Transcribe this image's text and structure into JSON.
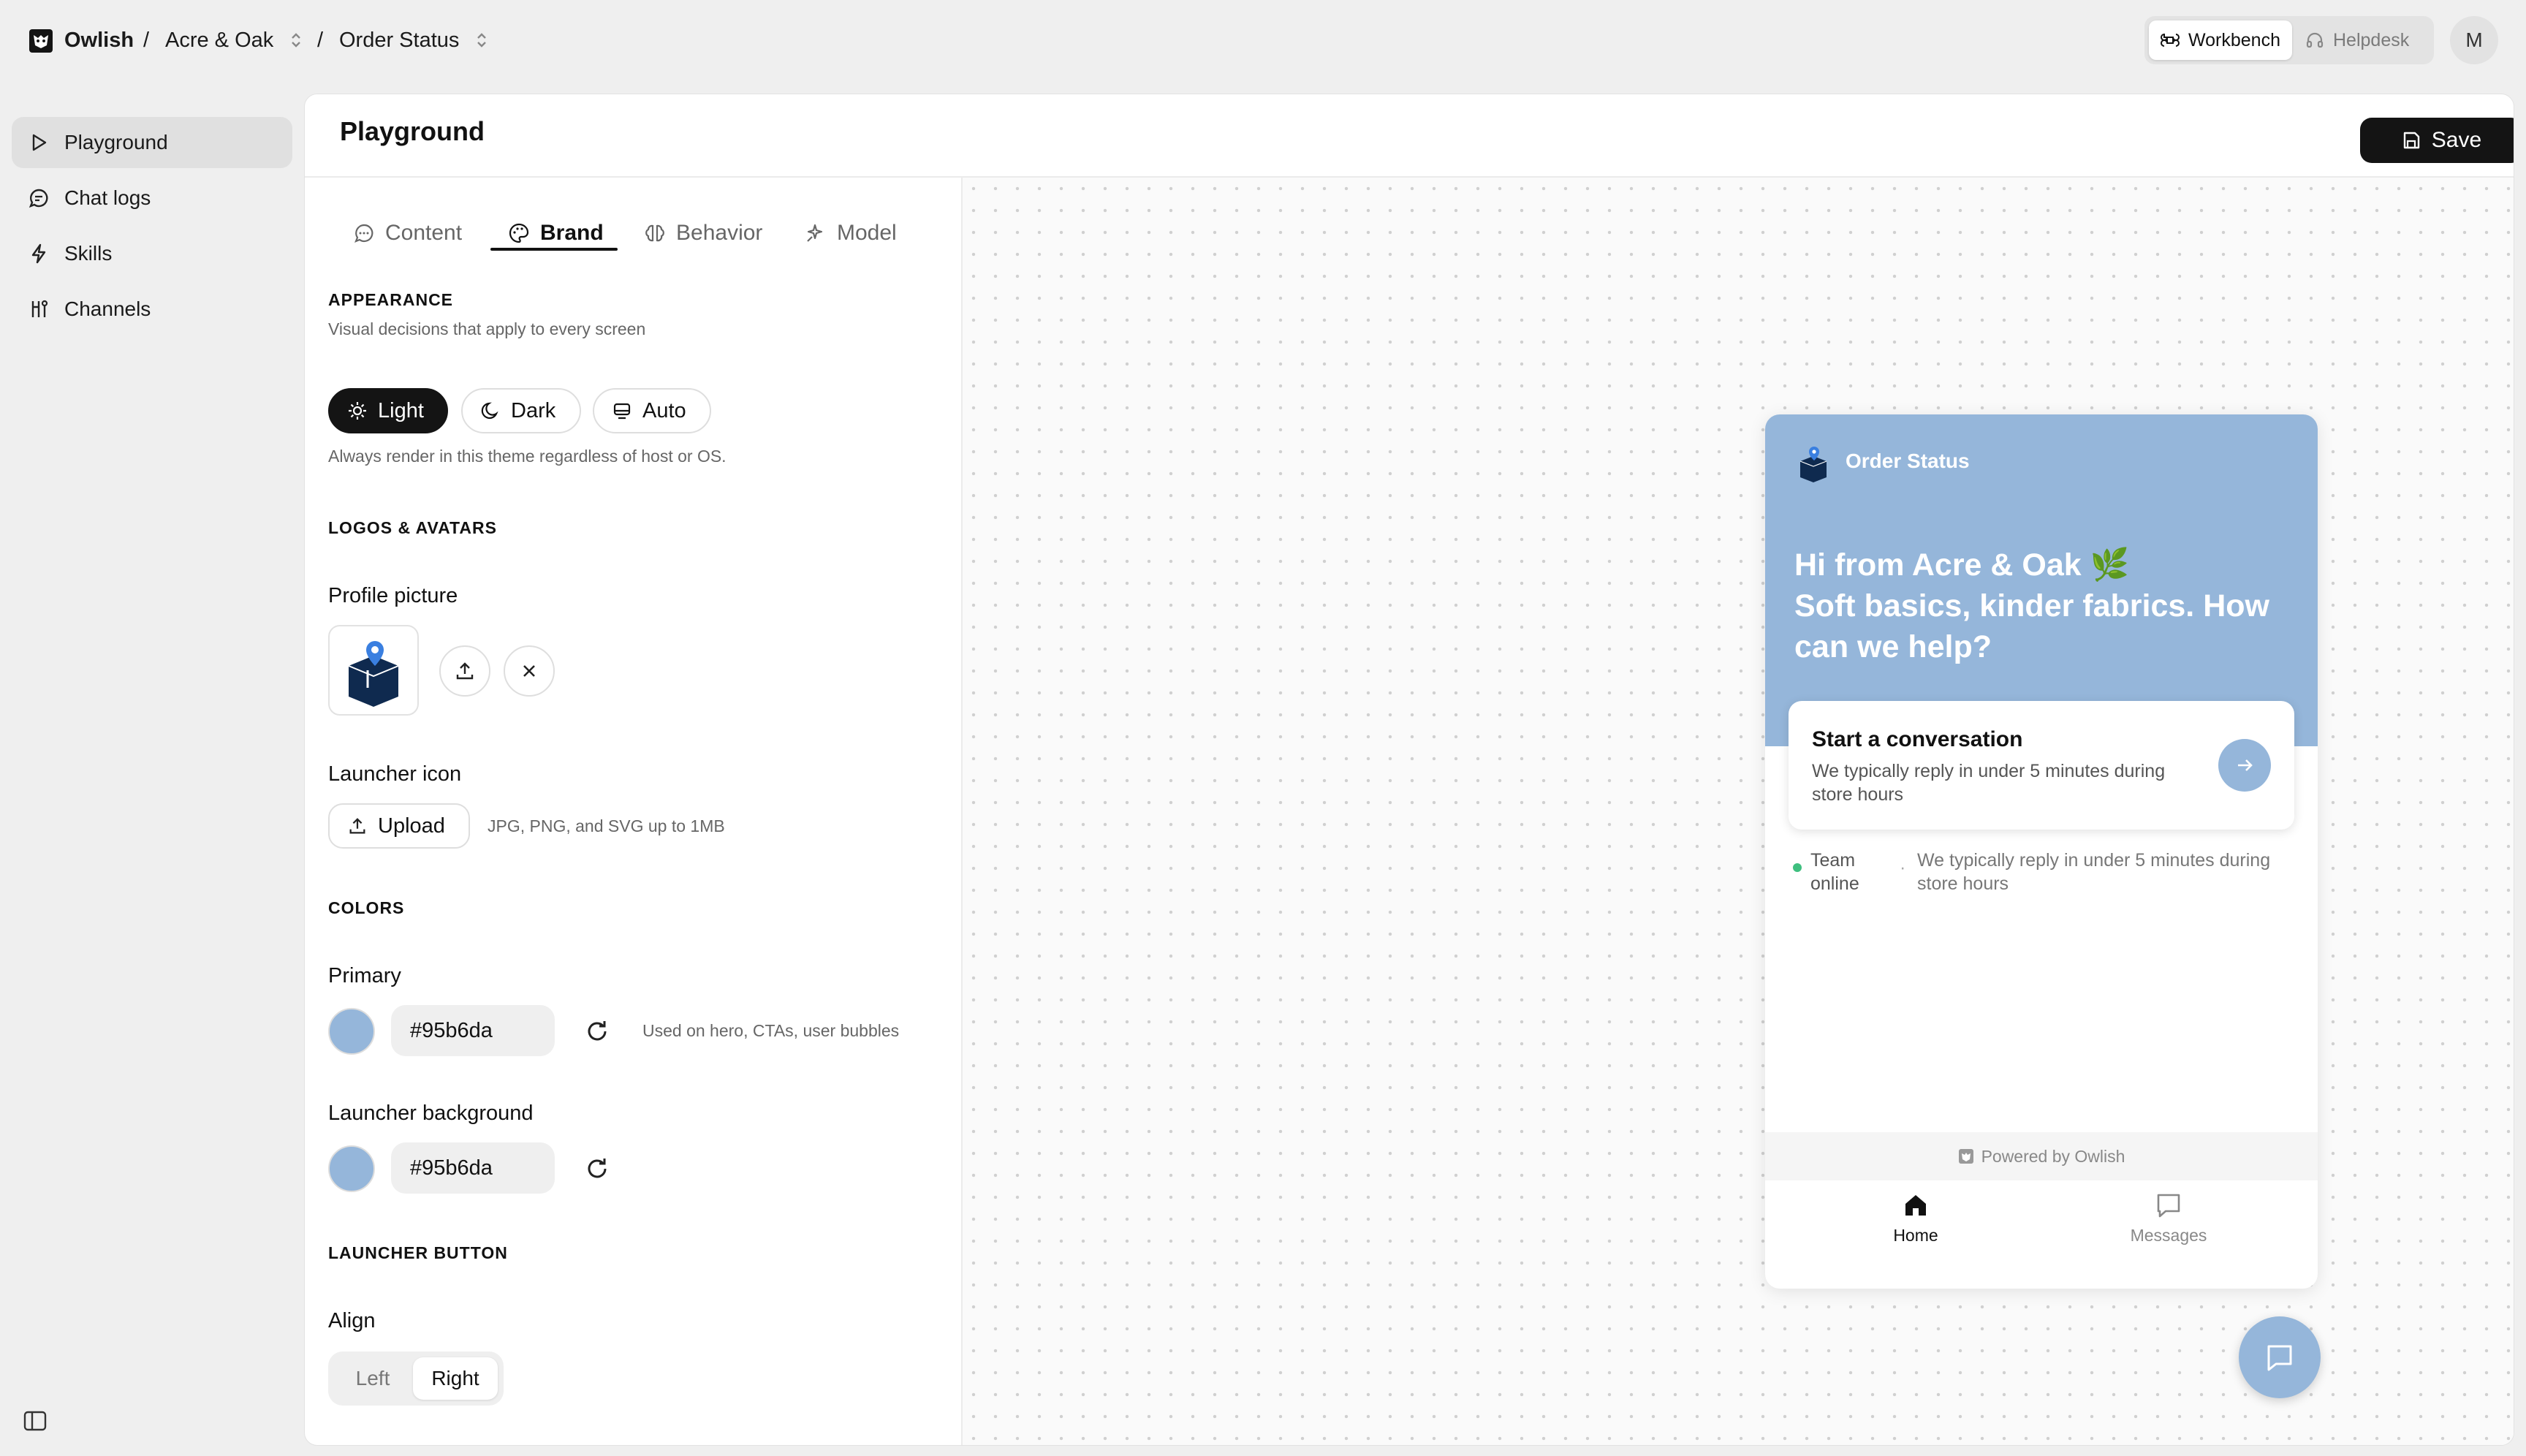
{
  "topbar": {
    "brand": "Owlish",
    "workspace": "Acre & Oak",
    "page": "Order Status",
    "separator": "/",
    "modes": {
      "workbench": "Workbench",
      "helpdesk": "Helpdesk"
    },
    "avatar_initial": "M"
  },
  "sidebar": {
    "items": [
      {
        "label": "Playground",
        "icon": "play-icon"
      },
      {
        "label": "Chat logs",
        "icon": "chat-icon"
      },
      {
        "label": "Skills",
        "icon": "bolt-icon"
      },
      {
        "label": "Channels",
        "icon": "channels-icon"
      }
    ]
  },
  "main": {
    "title": "Playground",
    "save_label": "Save",
    "tabs": [
      {
        "label": "Content",
        "icon": "chat-bubble-icon"
      },
      {
        "label": "Brand",
        "icon": "palette-icon"
      },
      {
        "label": "Behavior",
        "icon": "brain-icon"
      },
      {
        "label": "Model",
        "icon": "sparkle-icon"
      }
    ],
    "active_tab": "Brand"
  },
  "brand": {
    "appearance": {
      "heading": "APPEARANCE",
      "subtitle": "Visual decisions that apply to every screen",
      "themes": [
        "Light",
        "Dark",
        "Auto"
      ],
      "selected_theme": "Light",
      "hint": "Always render in this theme regardless of host or OS."
    },
    "logos": {
      "heading": "LOGOS & AVATARS",
      "profile_label": "Profile picture",
      "launcher_label": "Launcher icon",
      "upload_label": "Upload",
      "upload_hint": "JPG, PNG, and SVG up to 1MB"
    },
    "colors": {
      "heading": "COLORS",
      "primary_label": "Primary",
      "primary_value": "#95b6da",
      "primary_hint": "Used on hero, CTAs, user bubbles",
      "launcher_bg_label": "Launcher background",
      "launcher_bg_value": "#95b6da"
    },
    "launcher_button": {
      "heading": "LAUNCHER BUTTON",
      "align_label": "Align",
      "options": [
        "Left",
        "Right"
      ],
      "selected": "Right"
    }
  },
  "preview": {
    "widget_title": "Order Status",
    "greeting_line1": "Hi from Acre & Oak 🌿",
    "greeting_line2": "Soft basics, kinder fabrics. How can we help?",
    "card_title": "Start a conversation",
    "card_subtitle": "We typically reply in under 5 minutes during store hours",
    "status_label": "Team online",
    "status_dot": "·",
    "status_text": "We typically reply in under 5 minutes during store hours",
    "powered_by": "Powered by Owlish",
    "nav": {
      "home": "Home",
      "messages": "Messages"
    }
  },
  "colors": {
    "primary": "#95b6da",
    "online": "#3fbf7f",
    "ink": "#141414"
  }
}
